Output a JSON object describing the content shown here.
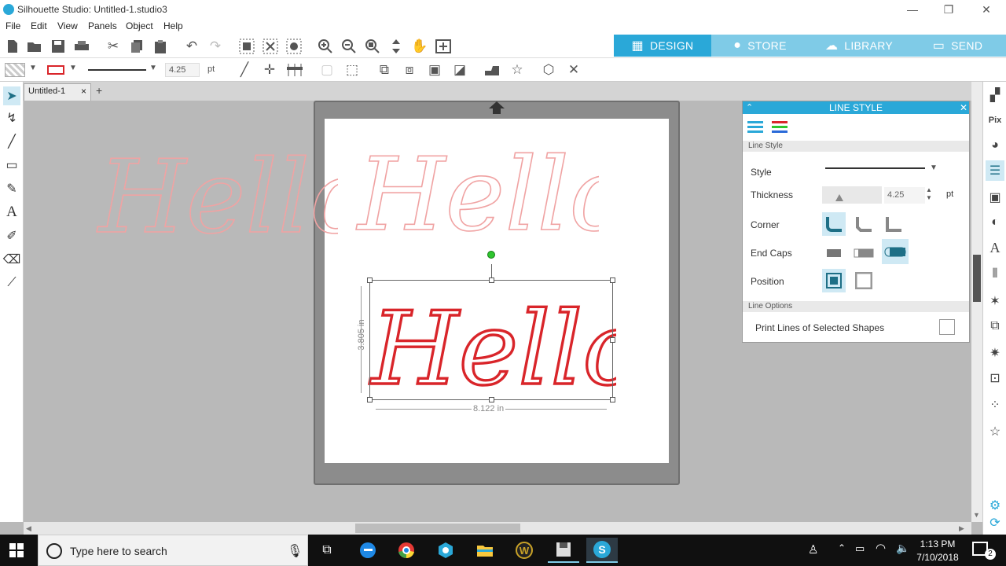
{
  "window": {
    "title": "Silhouette Studio: Untitled-1.studio3",
    "minimize": "—",
    "maximize": "❐",
    "close": "✕"
  },
  "menu": [
    "File",
    "Edit",
    "View",
    "Panels",
    "Object",
    "Help"
  ],
  "top_tabs": [
    {
      "label": "DESIGN",
      "active": true
    },
    {
      "label": "STORE",
      "active": false
    },
    {
      "label": "LIBRARY",
      "active": false
    },
    {
      "label": "SEND",
      "active": false
    }
  ],
  "toolbar2": {
    "line_thickness": "4.25",
    "unit": "pt"
  },
  "document_tab": {
    "label": "Untitled-1",
    "close": "×",
    "add": "+"
  },
  "canvas": {
    "text_art": "Hello",
    "height_dim": "3.805 in",
    "width_dim": "8.122 in"
  },
  "panel": {
    "title": "LINE STYLE",
    "section_line_style": "Line Style",
    "style_label": "Style",
    "thickness_label": "Thickness",
    "thickness_value": "4.25",
    "thickness_unit": "pt",
    "thickness_fraction": 0.25,
    "corner_label": "Corner",
    "endcaps_label": "End Caps",
    "position_label": "Position",
    "section_line_options": "Line Options",
    "print_lines_label": "Print Lines of Selected Shapes"
  },
  "taskbar": {
    "search_placeholder": "Type here to search",
    "time": "1:13 PM",
    "date": "7/10/2018",
    "notification_count": "2"
  },
  "colors": {
    "accent": "#2aa8d8",
    "tab_inactive": "#7fcbe7",
    "hello_red": "#d9252a",
    "hello_pink": "#f0a3a3",
    "panel_icon_teal": "#1e6f86"
  }
}
